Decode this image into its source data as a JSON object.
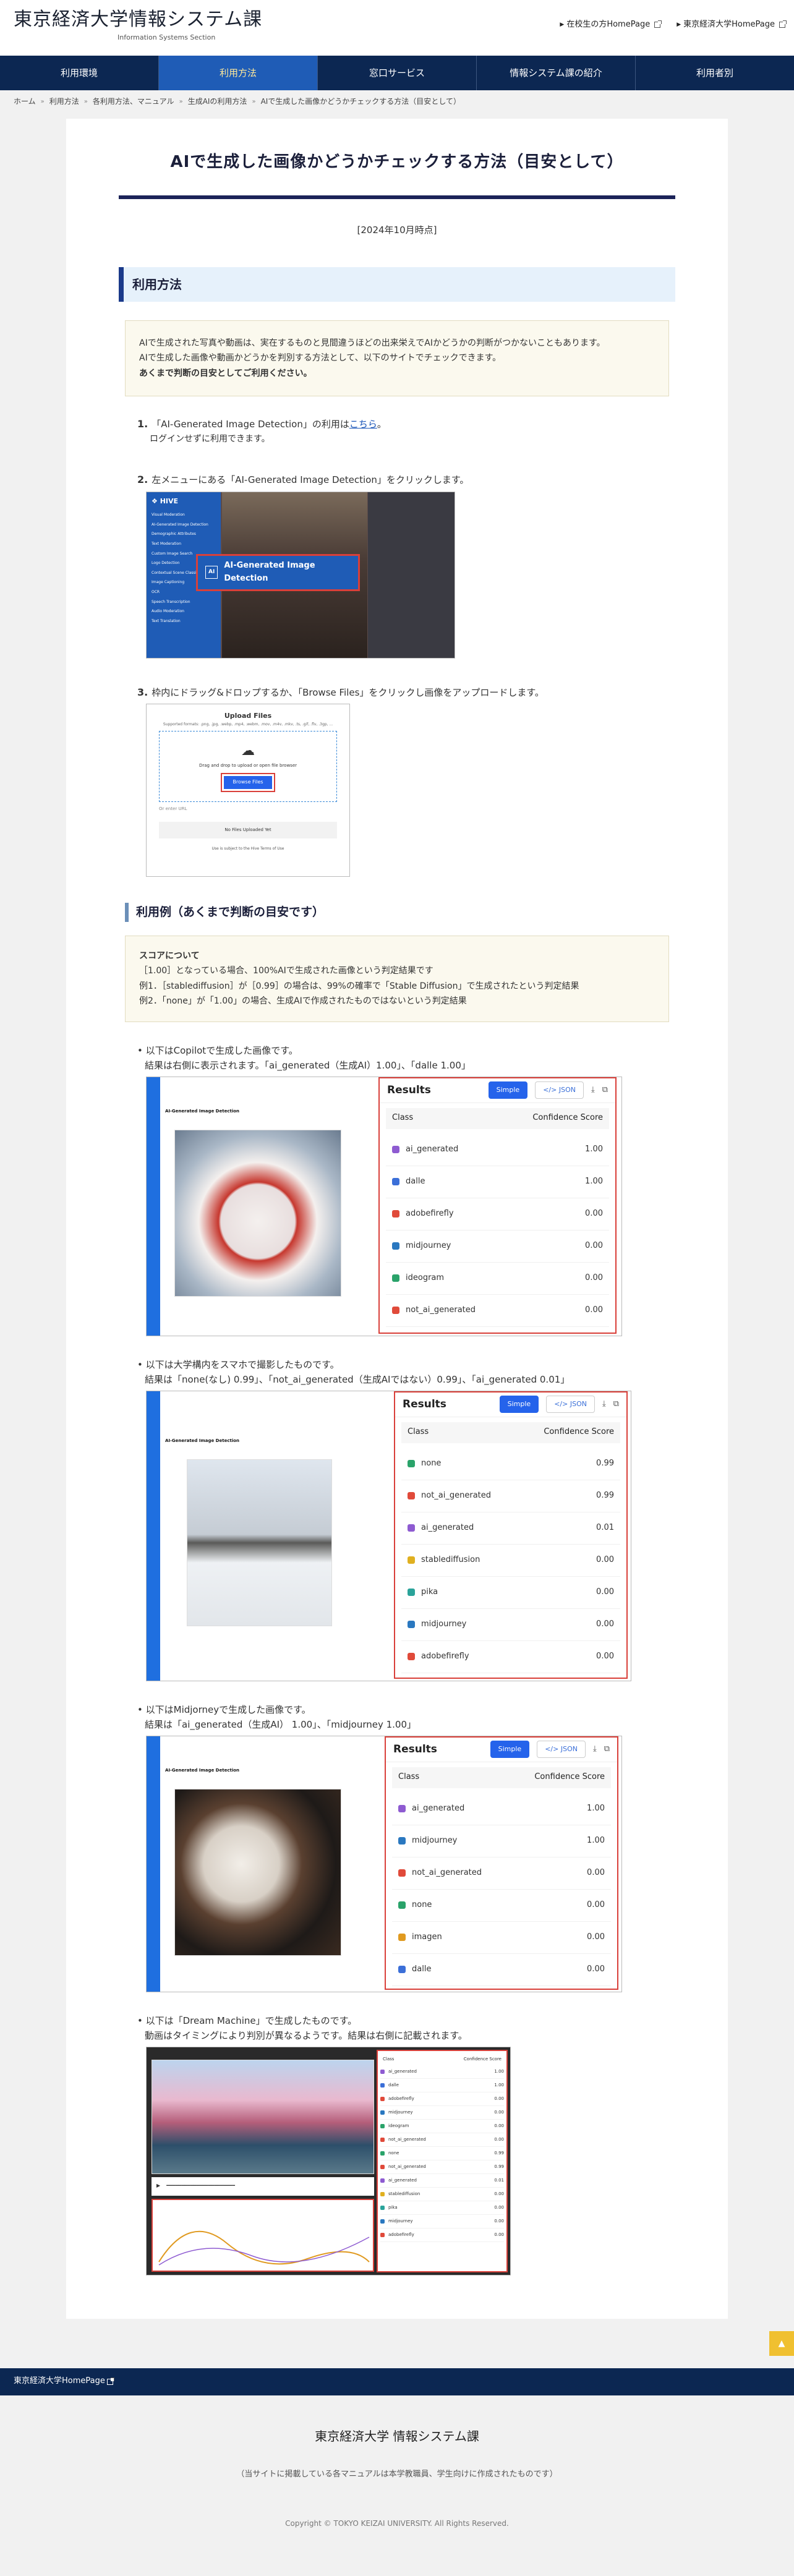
{
  "header": {
    "title": "東京経済大学情報システム課",
    "subtitle": "Information Systems Section",
    "links": [
      "在校生の方HomePage",
      "東京経済大学HomePage"
    ]
  },
  "nav": [
    "利用環境",
    "利用方法",
    "窓口サービス",
    "情報システム課の紹介",
    "利用者別"
  ],
  "breadcrumb": [
    "ホーム",
    "利用方法",
    "各利用方法、マニュアル",
    "生成AIの利用方法",
    "AIで生成した画像かどうかチェックする方法（目安として）"
  ],
  "page": {
    "title": "AIで生成した画像かどうかチェックする方法（目安として）",
    "date": "[2024年10月時点]"
  },
  "section1": {
    "title": "利用方法",
    "note": [
      "AIで生成された写真や動画は、実在するものと見間違うほどの出来栄えでAIかどうかの判断がつかないこともあります。",
      "AIで生成した画像や動画かどうかを判別する方法として、以下のサイトでチェックできます。",
      "あくまで判断の目安としてご利用ください。"
    ],
    "steps": [
      {
        "num": "1.",
        "text": "「AI-Generated Image Detection」の利用は",
        "link": "こちら",
        "suffix": "。",
        "sub": "ログインせずに利用できます。"
      },
      {
        "num": "2.",
        "text": "左メニューにある「AI-Generated Image Detection」をクリックします。"
      },
      {
        "num": "3.",
        "text": "枠内にドラッグ&ドロップするか、「Browse Files」をクリックし画像をアップロードします。"
      }
    ],
    "hive_menu": [
      "Visual Moderation",
      "AI-Generated Image Detection",
      "Demographic Attributes",
      "Text Moderation",
      "Custom Image Search",
      "Logo Detection",
      "Contextual Scene Classification",
      "Image Captioning",
      "OCR",
      "Speech Transcription",
      "Audio Moderation",
      "Text Translation"
    ],
    "hive_button": "AI-Generated Image Detection",
    "upload": {
      "title": "Upload Files",
      "formats": "Supported formats: .png, .jpg, .webp, .mp4, .webm, .mov, .m4v, .mkv, .ts, .gif, .flv, .3gp, ...",
      "drag": "Drag and drop to upload or open file browser",
      "button": "Browse Files",
      "url": "Or enter URL",
      "none": "No Files Uploaded Yet",
      "terms": "Use is subject to the Hive Terms of Use"
    }
  },
  "section2": {
    "title": "利用例（あくまで判断の目安です）",
    "score_title": "スコアについて",
    "score_lines": [
      "［1.00］となっている場合、100%AIで生成された画像という判定結果です",
      "例1．［stablediffusion］が［0.99］の場合は、99%の確率で「Stable Diffusion」で生成されたという判定結果",
      "例2．「none」が「1.00」の場合、生成AIで作成されたものではないという判定結果"
    ],
    "examples": [
      {
        "line1": "以下はCopilotで生成した画像です。",
        "line2": "結果は右側に表示されます。「ai_generated（生成AI）1.00」、「dalle 1.00」",
        "rows": [
          [
            "ai_generated",
            "1.00",
            "#8e5bd1"
          ],
          [
            "dalle",
            "1.00",
            "#3b6fd8"
          ],
          [
            "adobefirefly",
            "0.00",
            "#e04a3a"
          ],
          [
            "midjourney",
            "0.00",
            "#2a78c0"
          ],
          [
            "ideogram",
            "0.00",
            "#2aa36a"
          ],
          [
            "not_ai_generated",
            "0.00",
            "#e04a3a"
          ]
        ]
      },
      {
        "line1": "以下は大学構内をスマホで撮影したものです。",
        "line2": "結果は「none(なし) 0.99」、「not_ai_generated（生成AIではない）0.99」、「ai_generated 0.01」",
        "rows": [
          [
            "none",
            "0.99",
            "#2aa36a"
          ],
          [
            "not_ai_generated",
            "0.99",
            "#e04a3a"
          ],
          [
            "ai_generated",
            "0.01",
            "#8e5bd1"
          ],
          [
            "stablediffusion",
            "0.00",
            "#e0b020"
          ],
          [
            "pika",
            "0.00",
            "#2aa39a"
          ],
          [
            "midjourney",
            "0.00",
            "#2a78c0"
          ],
          [
            "adobefirefly",
            "0.00",
            "#e04a3a"
          ]
        ]
      },
      {
        "line1": "以下はMidjorneyで生成した画像です。",
        "line2": "結果は「ai_generated（生成AI） 1.00」、「midjourney 1.00」",
        "rows": [
          [
            "ai_generated",
            "1.00",
            "#8e5bd1"
          ],
          [
            "midjourney",
            "1.00",
            "#2a78c0"
          ],
          [
            "not_ai_generated",
            "0.00",
            "#e04a3a"
          ],
          [
            "none",
            "0.00",
            "#2aa36a"
          ],
          [
            "imagen",
            "0.00",
            "#e09a20"
          ],
          [
            "dalle",
            "0.00",
            "#3b6fd8"
          ]
        ]
      },
      {
        "line1": "以下は「Dream Machine」で生成したものです。",
        "line2": "動画はタイミングにより判別が異なるようです。結果は右側に記載されます。"
      }
    ],
    "results_label": "Results",
    "simple": "Simple",
    "json": "</> JSON",
    "class": "Class",
    "confidence": "Confidence Score"
  },
  "footer": {
    "link": "東京経済大学HomePage",
    "name": "東京経済大学 情報システム課",
    "desc": "（当サイトに掲載している各マニュアルは本学教職員、学生向けに作成されたものです）",
    "copyright": "Copyright © TOKYO KEIZAI UNIVERSITY. All Rights Reserved."
  }
}
